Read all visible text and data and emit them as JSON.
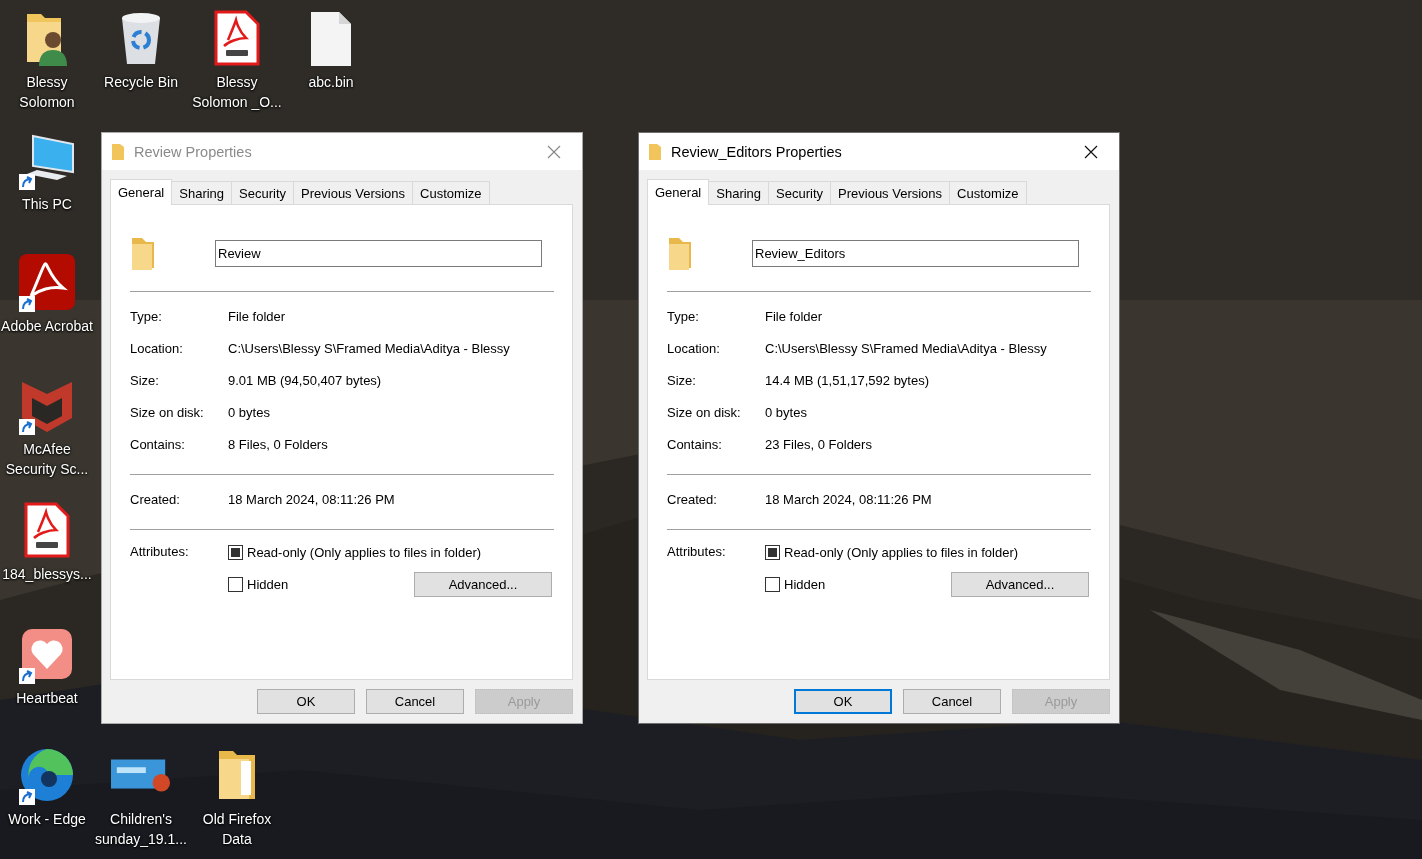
{
  "desktop_icons": [
    {
      "label": "Blessy Solomon",
      "kind": "person-folder",
      "shortcut": false
    },
    {
      "label": "Recycle Bin",
      "kind": "recycle-bin",
      "shortcut": false
    },
    {
      "label": "Blessy Solomon _O...",
      "kind": "pdf",
      "shortcut": false
    },
    {
      "label": "abc.bin",
      "kind": "blank-file",
      "shortcut": false
    },
    {
      "label": "This PC",
      "kind": "computer",
      "shortcut": true
    },
    {
      "label": "Adobe Acrobat",
      "kind": "acrobat",
      "shortcut": true
    },
    {
      "label": "McAfee Security Sc...",
      "kind": "shield",
      "shortcut": true
    },
    {
      "label": "184_blessys...",
      "kind": "pdf",
      "shortcut": false
    },
    {
      "label": "Heartbeat",
      "kind": "heart",
      "shortcut": true
    },
    {
      "label": "Work - Edge",
      "kind": "browser",
      "shortcut": true
    },
    {
      "label": "Children's sunday_19.1...",
      "kind": "slides",
      "shortcut": false
    },
    {
      "label": "Old Firefox Data",
      "kind": "folder",
      "shortcut": false
    }
  ],
  "windows": [
    {
      "title": "Review Properties",
      "active": false,
      "tabs": [
        {
          "label": "General",
          "selected": true
        },
        {
          "label": "Sharing",
          "selected": false
        },
        {
          "label": "Security",
          "selected": false
        },
        {
          "label": "Previous Versions",
          "selected": false
        },
        {
          "label": "Customize",
          "selected": false
        }
      ],
      "name_value": "Review",
      "sections": [
        [
          {
            "label": "Type:",
            "value": "File folder"
          },
          {
            "label": "Location:",
            "value": "C:\\Users\\Blessy S\\Framed Media\\Aditya - Blessy"
          },
          {
            "label": "Size:",
            "value": "9.01 MB (94,50,407 bytes)"
          },
          {
            "label": "Size on disk:",
            "value": "0 bytes"
          },
          {
            "label": "Contains:",
            "value": "8 Files, 0 Folders"
          }
        ],
        [
          {
            "label": "Created:",
            "value": "18 March 2024, 08:11:26 PM"
          }
        ]
      ],
      "attributes": {
        "label": "Attributes:",
        "options": [
          {
            "label": "Read-only (Only applies to files in folder)",
            "checked": true
          },
          {
            "label": "Hidden",
            "checked": false
          }
        ],
        "advanced": "Advanced..."
      },
      "buttons": [
        {
          "label": "OK",
          "default": false,
          "disabled": false
        },
        {
          "label": "Cancel",
          "default": false,
          "disabled": false
        },
        {
          "label": "Apply",
          "default": false,
          "disabled": true
        }
      ]
    },
    {
      "title": "Review_Editors Properties",
      "active": true,
      "tabs": [
        {
          "label": "General",
          "selected": true
        },
        {
          "label": "Sharing",
          "selected": false
        },
        {
          "label": "Security",
          "selected": false
        },
        {
          "label": "Previous Versions",
          "selected": false
        },
        {
          "label": "Customize",
          "selected": false
        }
      ],
      "name_value": "Review_Editors",
      "sections": [
        [
          {
            "label": "Type:",
            "value": "File folder"
          },
          {
            "label": "Location:",
            "value": "C:\\Users\\Blessy S\\Framed Media\\Aditya - Blessy"
          },
          {
            "label": "Size:",
            "value": "14.4 MB (1,51,17,592 bytes)"
          },
          {
            "label": "Size on disk:",
            "value": "0 bytes"
          },
          {
            "label": "Contains:",
            "value": "23 Files, 0 Folders"
          }
        ],
        [
          {
            "label": "Created:",
            "value": "18 March 2024, 08:11:26 PM"
          }
        ]
      ],
      "attributes": {
        "label": "Attributes:",
        "options": [
          {
            "label": "Read-only (Only applies to files in folder)",
            "checked": true
          },
          {
            "label": "Hidden",
            "checked": false
          }
        ],
        "advanced": "Advanced..."
      },
      "buttons": [
        {
          "label": "OK",
          "default": true,
          "disabled": false
        },
        {
          "label": "Cancel",
          "default": false,
          "disabled": false
        },
        {
          "label": "Apply",
          "default": false,
          "disabled": true
        }
      ]
    }
  ]
}
